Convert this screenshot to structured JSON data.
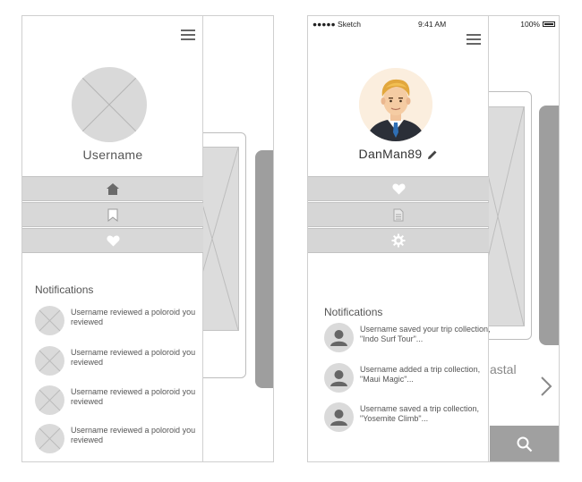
{
  "left_screen": {
    "username": "Username",
    "notifications_title": "Notifications",
    "notifications": [
      {
        "text": "Username reviewed a poloroid you reviewed"
      },
      {
        "text": "Username reviewed a poloroid you reviewed"
      },
      {
        "text": "Username reviewed a poloroid you reviewed"
      },
      {
        "text": "Username reviewed a poloroid you reviewed"
      }
    ],
    "nav_icons": [
      "home-icon",
      "bookmark-icon",
      "heart-icon"
    ]
  },
  "right_screen": {
    "status": {
      "carrier": "●●●●● Sketch",
      "time": "9:41 AM",
      "battery": "100%"
    },
    "username": "DanMan89",
    "notifications_title": "Notifications",
    "notifications": [
      {
        "text": "Username saved your trip collection, \"Indo Surf Tour\"..."
      },
      {
        "text": "Username added a trip collection, \"Maui Magic\"..."
      },
      {
        "text": "Username saved a trip collection, \"Yosemite Climb\"..."
      }
    ],
    "nav_icons": [
      "heart-icon",
      "document-icon",
      "gear-icon"
    ],
    "background_text": "astal"
  },
  "colors": {
    "nav_gray": "#d8d8d8",
    "icon_gray": "#6b6b6b",
    "search_gray": "#a0a0a0"
  }
}
